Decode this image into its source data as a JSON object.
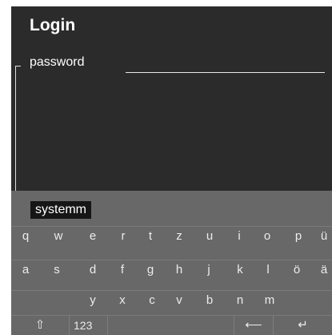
{
  "screen": {
    "title": "Login",
    "field_label": "password"
  },
  "keyboard": {
    "suggestion": "systemm",
    "row1": [
      "q",
      "w",
      "e",
      "r",
      "t",
      "z",
      "u",
      "i",
      "o",
      "p",
      "ü"
    ],
    "row2": [
      "a",
      "s",
      "d",
      "f",
      "g",
      "h",
      "j",
      "k",
      "l",
      "ö",
      "ä"
    ],
    "row3": [
      "y",
      "x",
      "c",
      "v",
      "b",
      "n",
      "m"
    ],
    "shift_symbol": "⇧",
    "numbers_label": "123",
    "backspace_symbol": "⟵",
    "enter_symbol": "↵"
  }
}
